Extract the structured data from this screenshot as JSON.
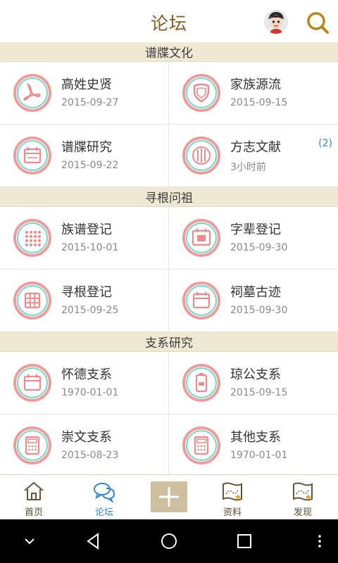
{
  "header": {
    "title": "论坛"
  },
  "sections": [
    {
      "title": "谱牒文化",
      "items": [
        {
          "title": "高姓史贤",
          "date": "2015-09-27",
          "icon": "acrobat-icon",
          "color": "#f08a8a"
        },
        {
          "title": "家族源流",
          "date": "2015-09-15",
          "icon": "shield-icon",
          "color": "#f08a8a"
        },
        {
          "title": "谱牒研究",
          "date": "2015-09-22",
          "icon": "calendar-icon",
          "color": "#f08a8a"
        },
        {
          "title": "方志文献",
          "date": "3小时前",
          "icon": "columns-icon",
          "color": "#f08a8a",
          "badge": "(2)"
        }
      ]
    },
    {
      "title": "寻根问祖",
      "items": [
        {
          "title": "族谱登记",
          "date": "2015-10-01",
          "icon": "dots-grid-icon",
          "color": "#f08a8a"
        },
        {
          "title": "字辈登记",
          "date": "2015-09-30",
          "icon": "calendar-date-icon",
          "color": "#f08a8a"
        },
        {
          "title": "寻根登记",
          "date": "2015-09-25",
          "icon": "grid-icon",
          "color": "#f08a8a"
        },
        {
          "title": "祠墓古迹",
          "date": "2015-09-30",
          "icon": "calendar-icon",
          "color": "#f08a8a"
        }
      ]
    },
    {
      "title": "支系研究",
      "items": [
        {
          "title": "怀德支系",
          "date": "1970-01-01",
          "icon": "calendar-icon",
          "color": "#f08a8a"
        },
        {
          "title": "琼公支系",
          "date": "2015-09-15",
          "icon": "battery-icon",
          "color": "#f08a8a"
        },
        {
          "title": "崇文支系",
          "date": "2015-08-23",
          "icon": "calculator-icon",
          "color": "#f08a8a"
        },
        {
          "title": "其他支系",
          "date": "1970-01-01",
          "icon": "calculator-icon",
          "color": "#f08a8a"
        }
      ]
    }
  ],
  "tabs": [
    {
      "label": "首页",
      "icon": "home-icon",
      "active": false
    },
    {
      "label": "论坛",
      "icon": "chat-bubbles-icon",
      "active": true
    },
    {
      "label": "",
      "icon": "plus-icon",
      "active": false
    },
    {
      "label": "资料",
      "icon": "map-scroll-icon",
      "active": false
    },
    {
      "label": "发现",
      "icon": "map-scroll-icon",
      "active": false
    }
  ],
  "colors": {
    "brand": "#8a5a1f",
    "section_bg": "#efe9d4",
    "active_tab": "#2e88d6",
    "plus_bg": "#cdbf9f"
  }
}
